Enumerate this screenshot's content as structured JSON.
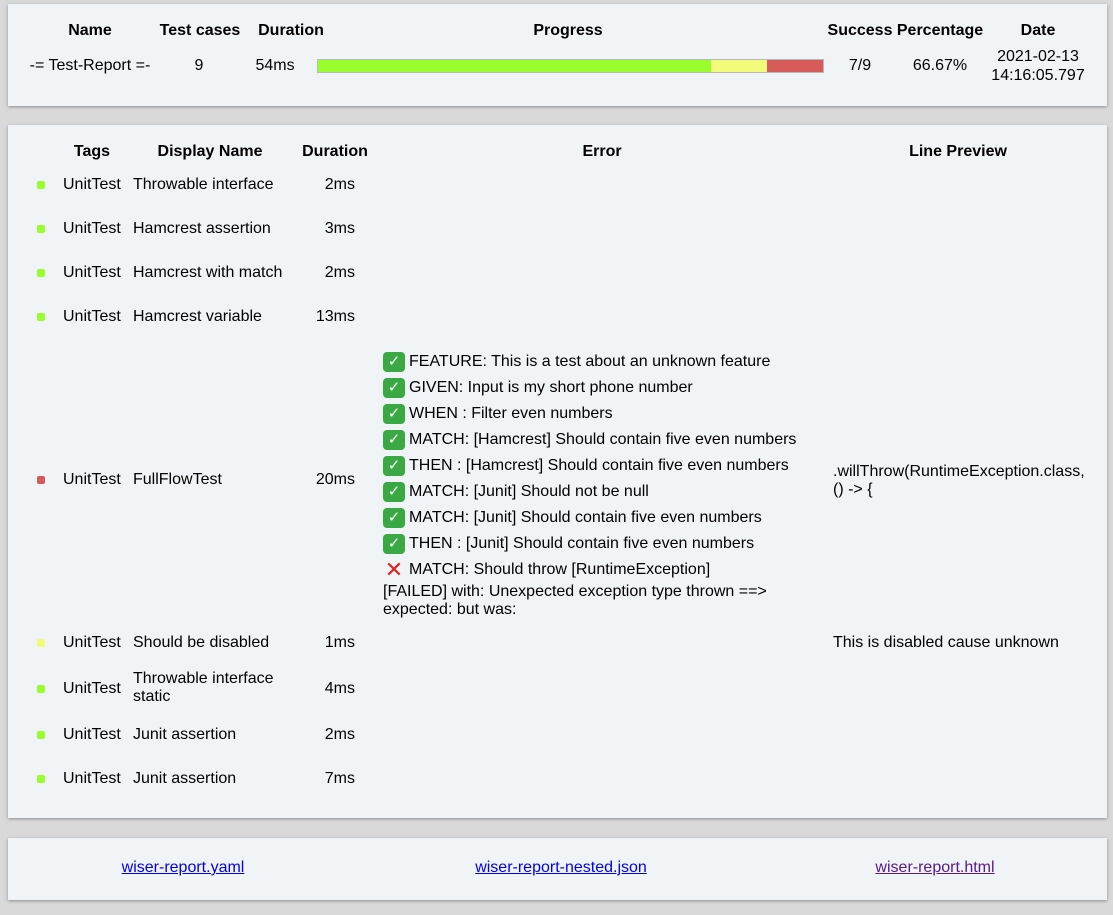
{
  "summary": {
    "headers": {
      "name": "Name",
      "test_cases": "Test cases",
      "duration": "Duration",
      "progress": "Progress",
      "success": "Success",
      "percentage": "Percentage",
      "date": "Date"
    },
    "name": "-= Test-Report =-",
    "test_cases": "9",
    "duration": "54ms",
    "progress": {
      "passed": 7,
      "disabled": 1,
      "failed": 1,
      "total": 9
    },
    "success": "7/9",
    "percentage": "66.67%",
    "date_line1": "2021-02-13",
    "date_line2": "14:16:05.797"
  },
  "colors": {
    "passed": "#9afe2e",
    "disabled": "#f2fb7a",
    "failed": "#d85b5b",
    "card_bg": "#f1f4f6",
    "page_bg": "#d9d9d9"
  },
  "tests": {
    "headers": {
      "tags": "Tags",
      "display_name": "Display Name",
      "duration": "Duration",
      "error": "Error",
      "line_preview": "Line Preview"
    },
    "rows": [
      {
        "status": "passed",
        "tag": "UnitTest",
        "name": "Throwable interface",
        "duration": "2ms"
      },
      {
        "status": "passed",
        "tag": "UnitTest",
        "name": "Hamcrest assertion",
        "duration": "3ms"
      },
      {
        "status": "passed",
        "tag": "UnitTest",
        "name": "Hamcrest with match",
        "duration": "2ms"
      },
      {
        "status": "passed",
        "tag": "UnitTest",
        "name": "Hamcrest variable",
        "duration": "13ms"
      },
      {
        "status": "failed",
        "tag": "UnitTest",
        "name": "FullFlowTest",
        "duration": "20ms",
        "error_lines": [
          {
            "icon": "check-icon",
            "text": "FEATURE: This is a test about an unknown feature"
          },
          {
            "icon": "check-icon",
            "text": "GIVEN: Input is my short phone number"
          },
          {
            "icon": "check-icon",
            "text": "WHEN : Filter even numbers"
          },
          {
            "icon": "check-icon",
            "text": "MATCH: [Hamcrest] Should contain five even numbers"
          },
          {
            "icon": "check-icon",
            "text": "THEN : [Hamcrest] Should contain five even numbers"
          },
          {
            "icon": "check-icon",
            "text": "MATCH: [Junit] Should not be null"
          },
          {
            "icon": "check-icon",
            "text": "MATCH: [Junit] Should contain five even numbers"
          },
          {
            "icon": "check-icon",
            "text": "THEN : [Junit] Should contain five even numbers"
          },
          {
            "icon": "cross-icon",
            "text": "MATCH: Should throw [RuntimeException]"
          }
        ],
        "error_tail_1": "[FAILED] with: Unexpected exception type thrown ==>",
        "error_tail_2": "expected: but was:",
        "preview_1": ".willThrow(RuntimeException.class,",
        "preview_2": "() -> {"
      },
      {
        "status": "disabled",
        "tag": "UnitTest",
        "name": "Should be disabled",
        "duration": "1ms",
        "preview": "This is disabled cause unknown"
      },
      {
        "status": "passed",
        "tag": "UnitTest",
        "name_1": "Throwable interface",
        "name_2": "static",
        "duration": "4ms"
      },
      {
        "status": "passed",
        "tag": "UnitTest",
        "name": "Junit assertion",
        "duration": "2ms"
      },
      {
        "status": "passed",
        "tag": "UnitTest",
        "name": "Junit assertion",
        "duration": "7ms"
      }
    ]
  },
  "links": {
    "yaml": "wiser-report.yaml",
    "nested_json": "wiser-report-nested.json",
    "html": "wiser-report.html"
  }
}
